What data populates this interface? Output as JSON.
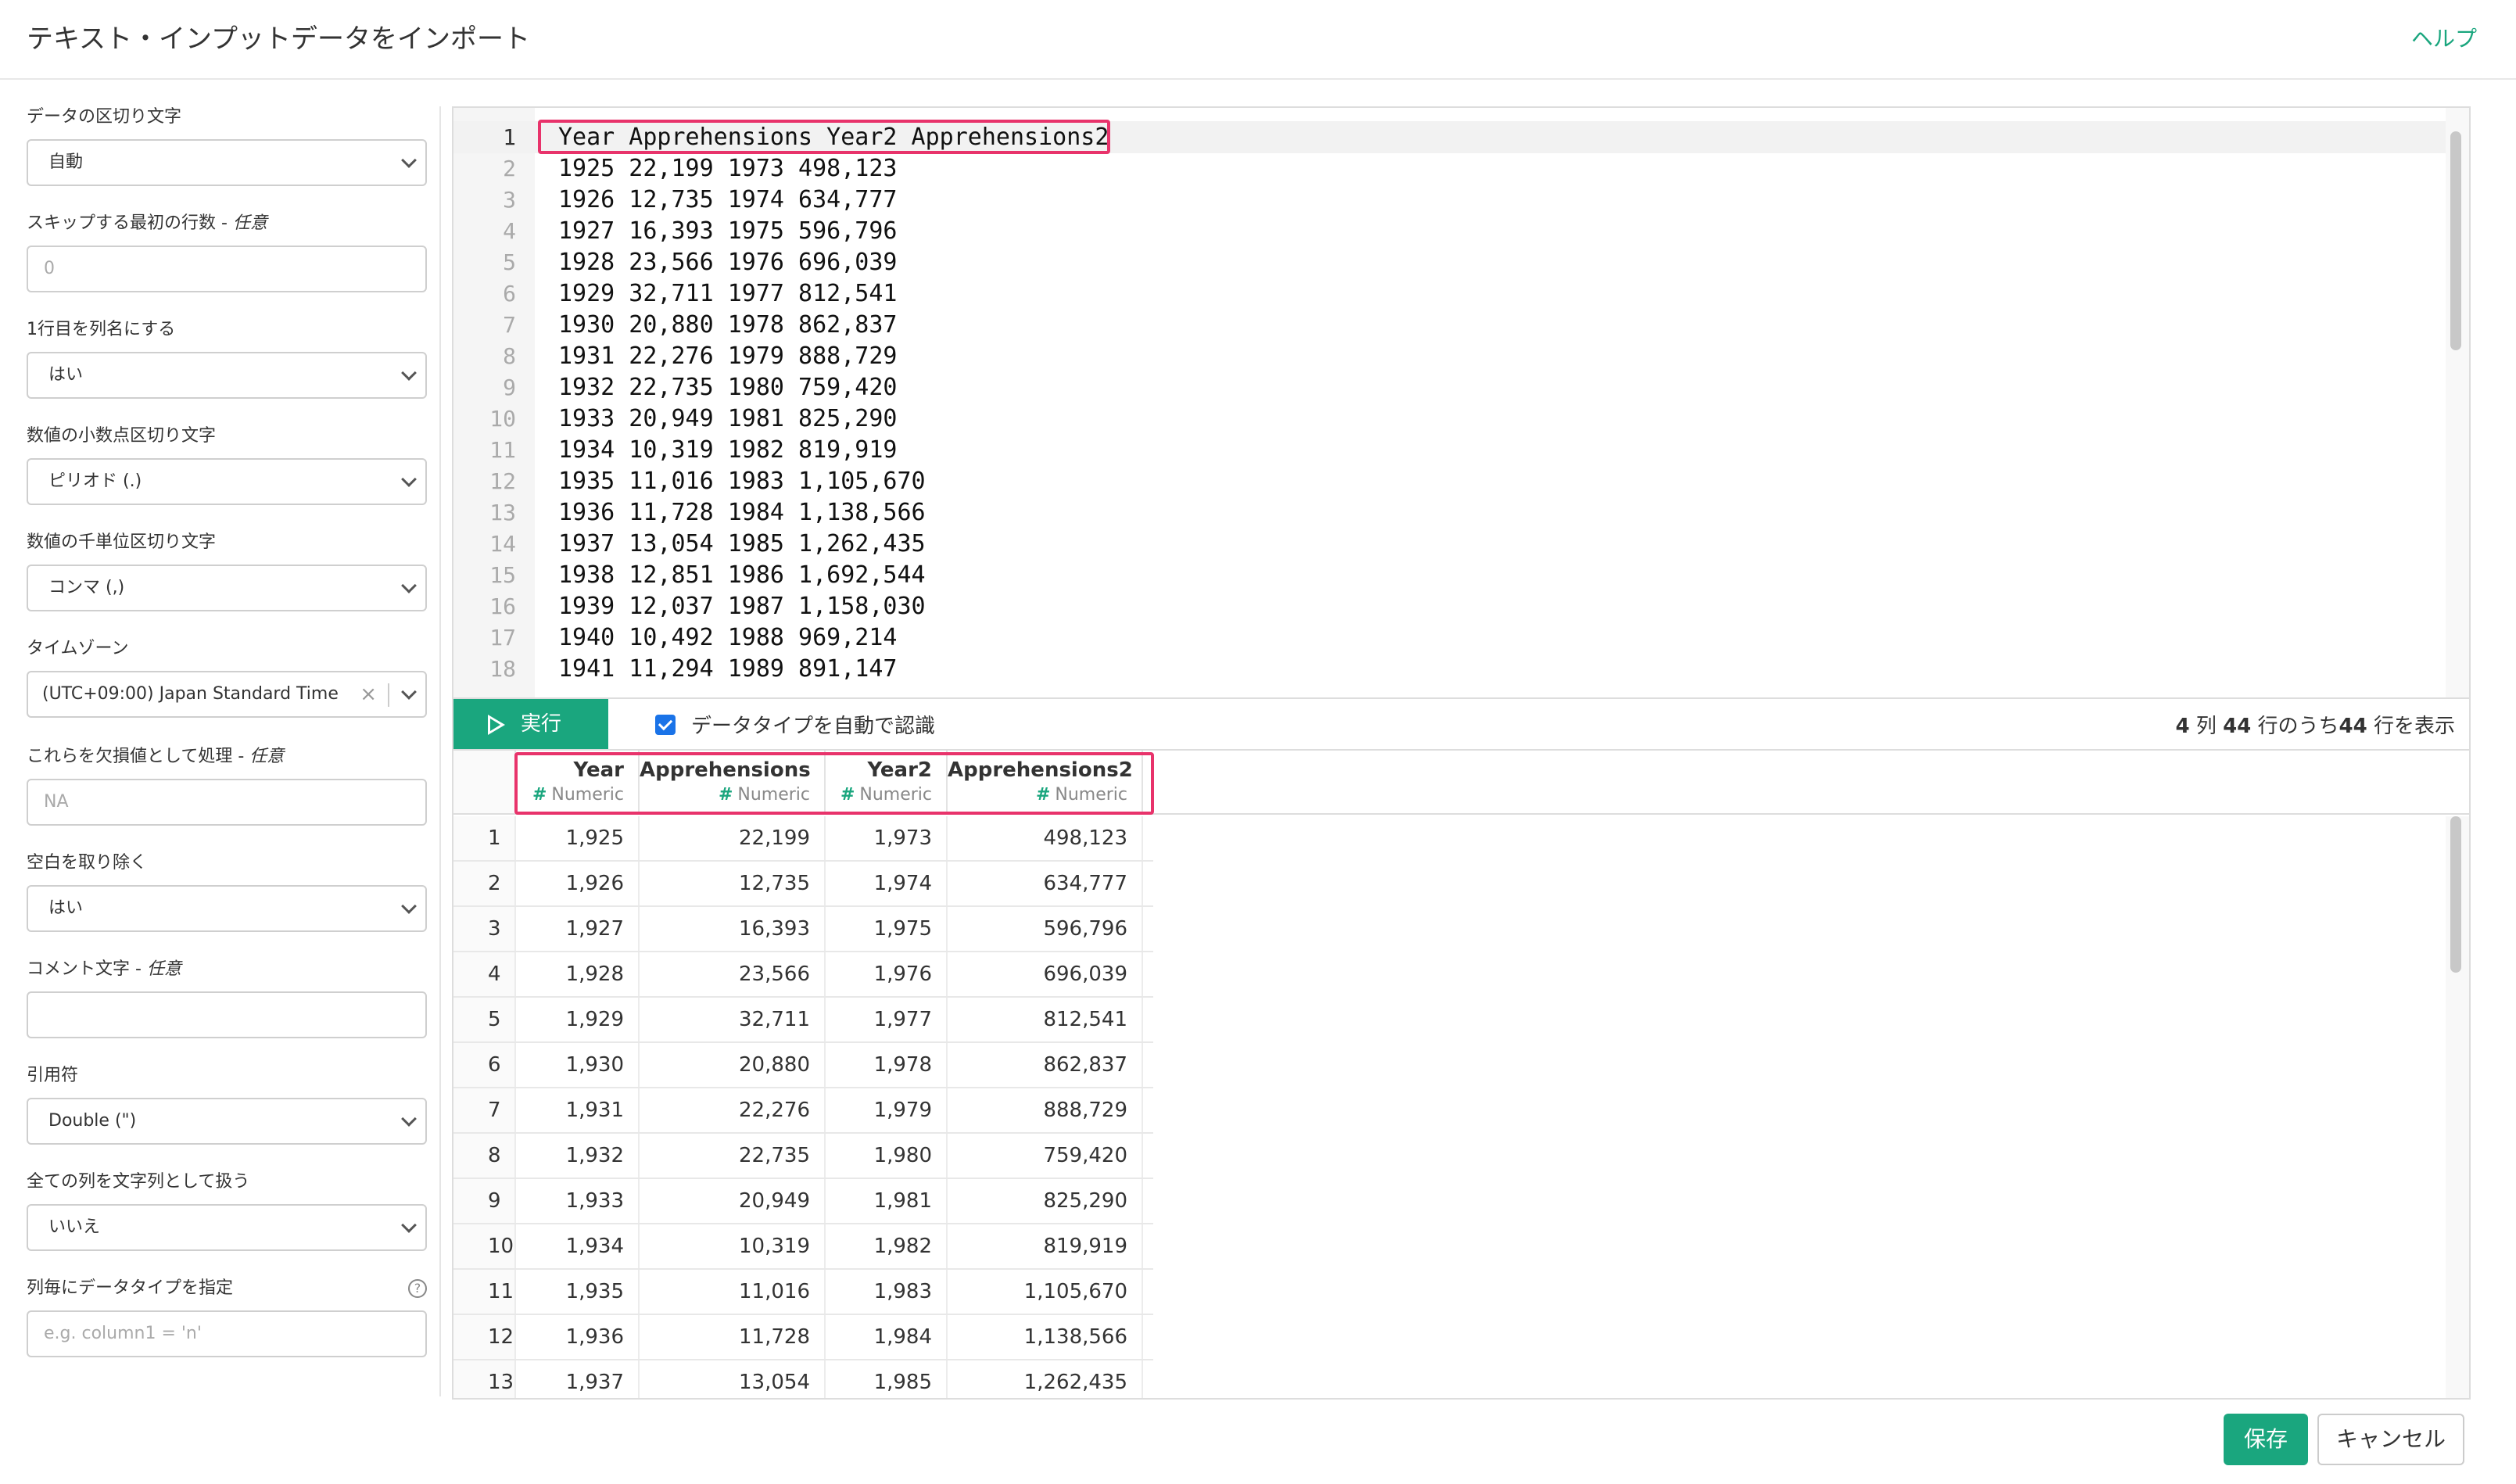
{
  "header": {
    "title": "テキスト・インプットデータをインポート",
    "help": "ヘルプ"
  },
  "sidebar": {
    "delimiter": {
      "label": "データの区切り文字",
      "value": "自動"
    },
    "skip_rows": {
      "label": "スキップする最初の行数 - ",
      "optional": "任意",
      "placeholder": "0"
    },
    "header_row": {
      "label": "1行目を列名にする",
      "value": "はい"
    },
    "decimal_sep": {
      "label": "数値の小数点区切り文字",
      "value": "ピリオド (.)"
    },
    "thousands_sep": {
      "label": "数値の千単位区切り文字",
      "value": "コンマ (,)"
    },
    "timezone": {
      "label": "タイムゾーン",
      "value": "(UTC+09:00) Japan Standard Time",
      "clear": "×"
    },
    "na_values": {
      "label": "これらを欠損値として処理 - ",
      "optional": "任意",
      "placeholder": "NA"
    },
    "trim_ws": {
      "label": "空白を取り除く",
      "value": "はい"
    },
    "comment": {
      "label": "コメント文字 - ",
      "optional": "任意",
      "placeholder": ""
    },
    "quote": {
      "label": "引用符",
      "value": "Double (\")"
    },
    "all_as_string": {
      "label": "全ての列を文字列として扱う",
      "value": "いいえ"
    },
    "col_types": {
      "label": "列毎にデータタイプを指定",
      "help": "?",
      "placeholder": "e.g. column1 = 'n'"
    }
  },
  "editor": {
    "lines": [
      "Year Apprehensions Year2 Apprehensions2",
      "1925 22,199 1973 498,123",
      "1926 12,735 1974 634,777",
      "1927 16,393 1975 596,796",
      "1928 23,566 1976 696,039",
      "1929 32,711 1977 812,541",
      "1930 20,880 1978 862,837",
      "1931 22,276 1979 888,729",
      "1932 22,735 1980 759,420",
      "1933 20,949 1981 825,290",
      "1934 10,319 1982 819,919",
      "1935 11,016 1983 1,105,670",
      "1936 11,728 1984 1,138,566",
      "1937 13,054 1985 1,262,435",
      "1938 12,851 1986 1,692,544",
      "1939 12,037 1987 1,158,030",
      "1940 10,492 1988 969,214",
      "1941 11,294 1989 891,147"
    ],
    "line_numbers": [
      "1",
      "2",
      "3",
      "4",
      "5",
      "6",
      "7",
      "8",
      "9",
      "10",
      "11",
      "12",
      "13",
      "14",
      "15",
      "16",
      "17",
      "18"
    ]
  },
  "toolbar": {
    "run_label": "実行",
    "auto_type_label": "データタイプを自動で認識",
    "auto_type_checked": true,
    "cols_count": "4",
    "cols_label": " 列  ",
    "rows_total": "44",
    "rows_mid": " 行のうち",
    "rows_shown": "44",
    "rows_end": " 行を表示"
  },
  "grid": {
    "columns": [
      {
        "name": "Year",
        "type": "Numeric"
      },
      {
        "name": "Apprehensions",
        "type": "Numeric"
      },
      {
        "name": "Year2",
        "type": "Numeric"
      },
      {
        "name": "Apprehensions2",
        "type": "Numeric"
      }
    ],
    "type_icon": "#",
    "rows": [
      [
        "1",
        "1,925",
        "22,199",
        "1,973",
        "498,123"
      ],
      [
        "2",
        "1,926",
        "12,735",
        "1,974",
        "634,777"
      ],
      [
        "3",
        "1,927",
        "16,393",
        "1,975",
        "596,796"
      ],
      [
        "4",
        "1,928",
        "23,566",
        "1,976",
        "696,039"
      ],
      [
        "5",
        "1,929",
        "32,711",
        "1,977",
        "812,541"
      ],
      [
        "6",
        "1,930",
        "20,880",
        "1,978",
        "862,837"
      ],
      [
        "7",
        "1,931",
        "22,276",
        "1,979",
        "888,729"
      ],
      [
        "8",
        "1,932",
        "22,735",
        "1,980",
        "759,420"
      ],
      [
        "9",
        "1,933",
        "20,949",
        "1,981",
        "825,290"
      ],
      [
        "10",
        "1,934",
        "10,319",
        "1,982",
        "819,919"
      ],
      [
        "11",
        "1,935",
        "11,016",
        "1,983",
        "1,105,670"
      ],
      [
        "12",
        "1,936",
        "11,728",
        "1,984",
        "1,138,566"
      ],
      [
        "13",
        "1,937",
        "13,054",
        "1,985",
        "1,262,435"
      ]
    ]
  },
  "footer": {
    "save": "保存",
    "cancel": "キャンセル"
  },
  "colors": {
    "accent": "#1aa67e",
    "highlight": "#e8336b",
    "checkbox": "#1a73e8"
  }
}
